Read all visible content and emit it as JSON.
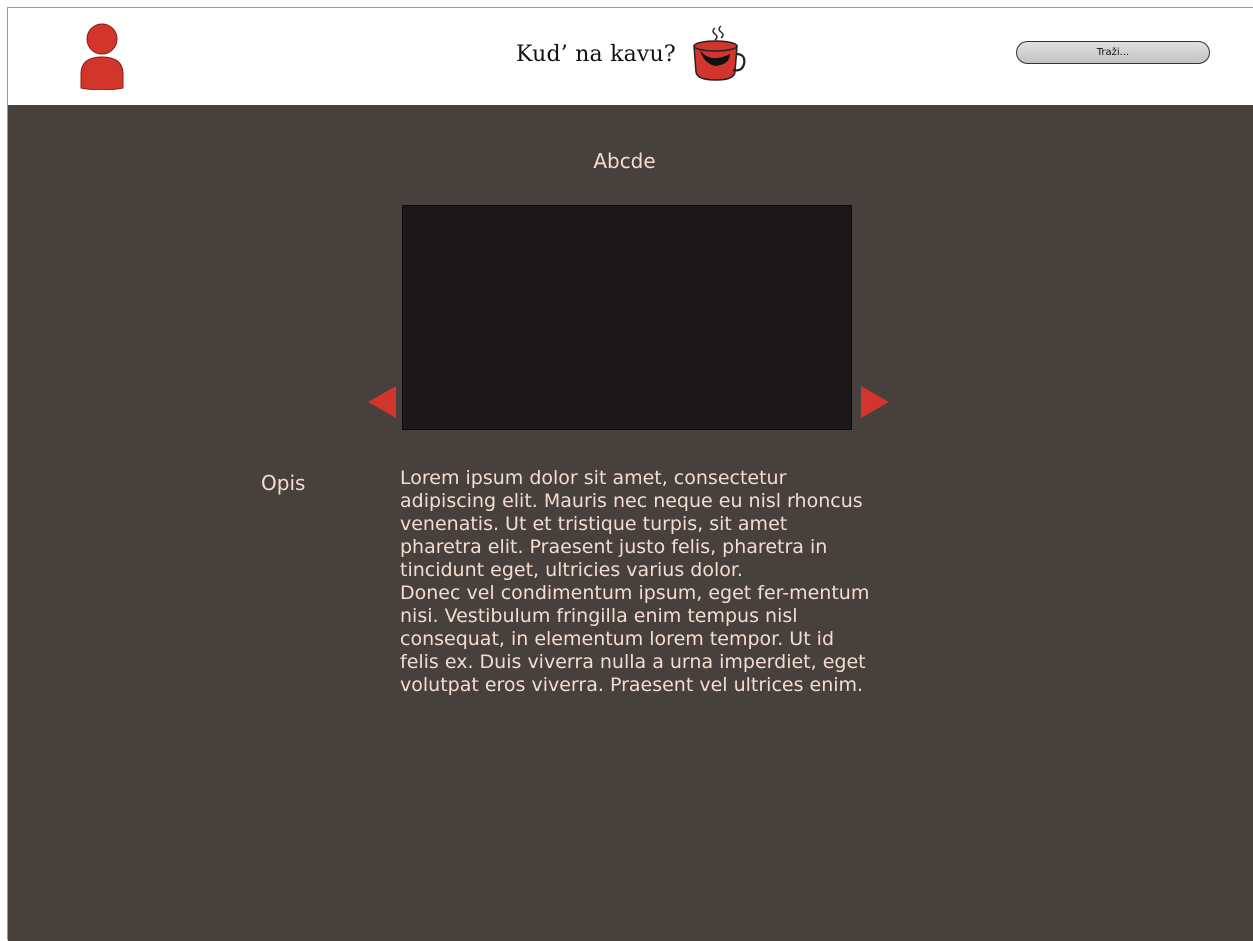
{
  "header": {
    "site_title": "Kud’ na kavu?",
    "search_label": "Traži..."
  },
  "place": {
    "name": "Abcde",
    "description_label": "Opis",
    "description_paragraphs": [
      "Lorem ipsum dolor sit amet, consectetur adipiscing elit. Mauris nec neque eu nisl rhoncus venenatis. Ut et tristique turpis, sit amet pharetra elit. Praesent justo felis, pharetra in tincidunt eget, ultricies varius dolor.",
      "Donec vel condimentum ipsum, eget fer-mentum nisi. Vestibulum fringilla enim tempus nisl consequat, in elementum lorem tempor. Ut id felis ex. Duis viverra nulla a urna imperdiet, eget volutpat eros viverra. Praesent vel ultrices enim."
    ]
  },
  "icons": {
    "avatar": "user-avatar-icon",
    "logo": "coffee-cup-icon",
    "prev": "arrow-left-icon",
    "next": "arrow-right-icon"
  },
  "colors": {
    "accent": "#d2352b",
    "background": "#48403c",
    "text": "#f3dcd0",
    "image_placeholder": "#1a1819"
  }
}
